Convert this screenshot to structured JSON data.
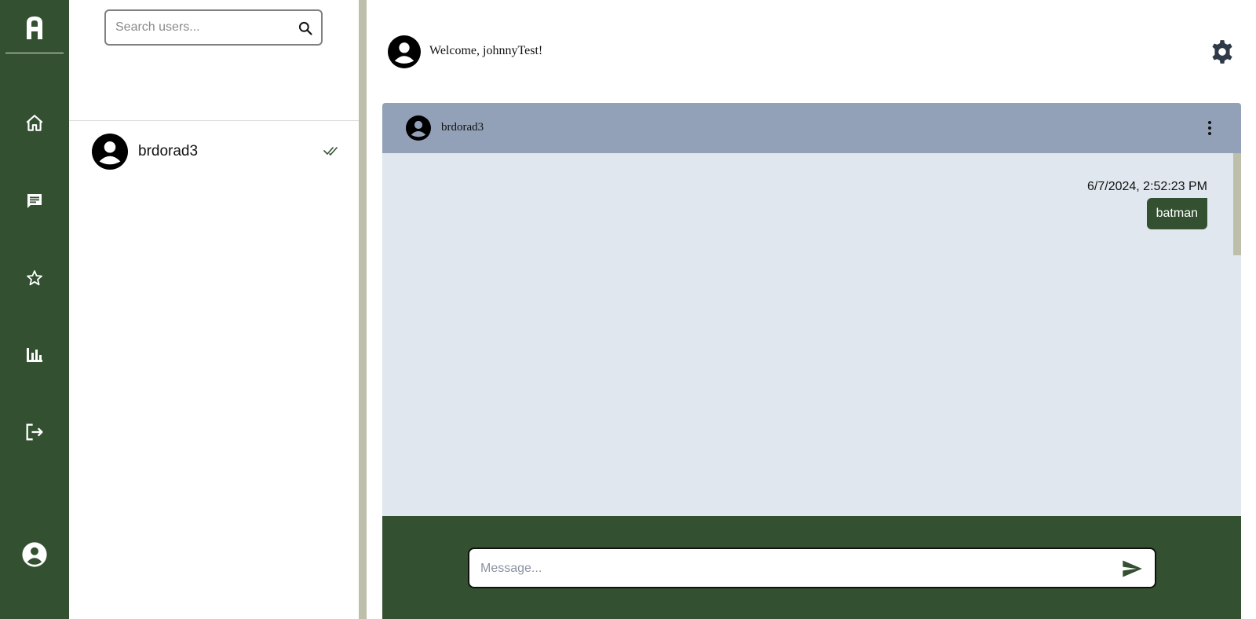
{
  "nav": {
    "logo_letter": "A",
    "items": [
      {
        "icon": "home-icon",
        "label": "Home"
      },
      {
        "icon": "chat-icon",
        "label": "Messages"
      },
      {
        "icon": "star-icon",
        "label": "Favorites"
      },
      {
        "icon": "bar-chart-icon",
        "label": "Statistics"
      },
      {
        "icon": "logout-icon",
        "label": "Logout"
      }
    ],
    "profile_icon": "account-icon"
  },
  "search": {
    "placeholder": "Search users..."
  },
  "users": [
    {
      "name": "brdorad3",
      "status_icon": "double-check-icon"
    }
  ],
  "header": {
    "welcome_text": "Welcome, johnnyTest!",
    "settings_icon": "gear-icon"
  },
  "chat": {
    "contact_name": "brdorad3",
    "messages": [
      {
        "timestamp": "6/7/2024, 2:52:23 PM",
        "text": "batman",
        "outgoing": true
      }
    ],
    "composer_placeholder": "Message..."
  },
  "colors": {
    "sidebar": "#335031",
    "chat_header": "#92a1b8",
    "chat_body": "#e1e7ef",
    "splitter": "#bdbfaa",
    "bubble": "#335031"
  }
}
